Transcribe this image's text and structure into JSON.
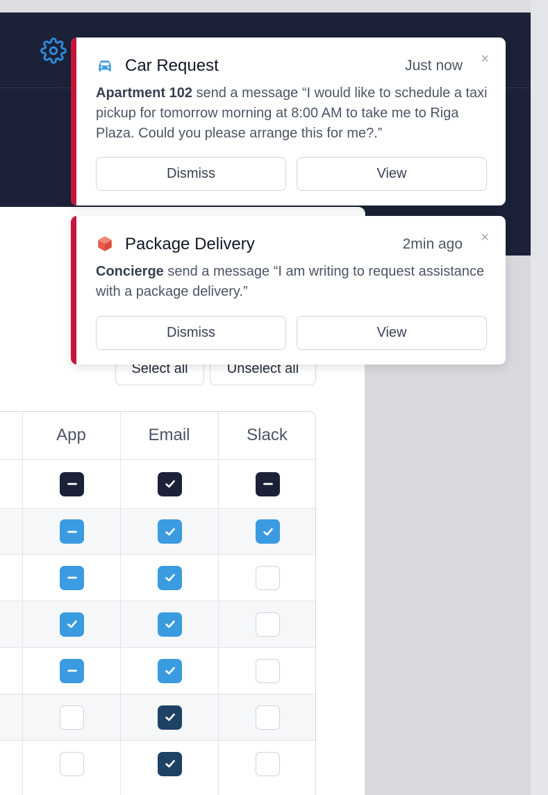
{
  "table": {
    "columns": [
      "App",
      "Email",
      "Slack"
    ],
    "rows": [
      {
        "app": "partial",
        "email": "checked",
        "slack": "partial",
        "style": "dark"
      },
      {
        "app": "partial",
        "email": "checked",
        "slack": "checked",
        "style": "blue"
      },
      {
        "app": "partial",
        "email": "checked",
        "slack": "unchecked",
        "style": "blue"
      },
      {
        "app": "checked",
        "email": "checked",
        "slack": "unchecked",
        "style": "blue"
      },
      {
        "app": "partial",
        "email": "checked",
        "slack": "unchecked",
        "style": "blue"
      },
      {
        "app": "unchecked",
        "email": "checked",
        "slack": "unchecked",
        "style": "navy"
      },
      {
        "app": "unchecked",
        "email": "checked",
        "slack": "unchecked",
        "style": "navy"
      }
    ]
  },
  "select_all_label": "Select all",
  "unselect_all_label": "Unselect all",
  "notifications": [
    {
      "icon": "car-icon",
      "title": "Car Request",
      "time": "Just now",
      "sender": "Apartment 102",
      "message": "send a message “I would like to schedule a taxi pickup for tomorrow morning at 8:00 AM to take me to Riga Plaza. Could you please arrange this for me?.”",
      "dismiss_label": "Dismiss",
      "view_label": "View",
      "close_label": "×"
    },
    {
      "icon": "package-icon",
      "title": "Package Delivery",
      "time": "2min ago",
      "sender": "Concierge",
      "message": "send a message “I am writing to request assistance with a package delivery.”",
      "dismiss_label": "Dismiss",
      "view_label": "View",
      "close_label": "×"
    }
  ],
  "colors": {
    "header_bg": "#1b2238",
    "accent_red": "#c8143b",
    "checkbox_blue": "#3a9be0",
    "checkbox_dark": "#1b2238",
    "checkbox_navy": "#1e4266",
    "gear_blue": "#2d8fe0"
  }
}
